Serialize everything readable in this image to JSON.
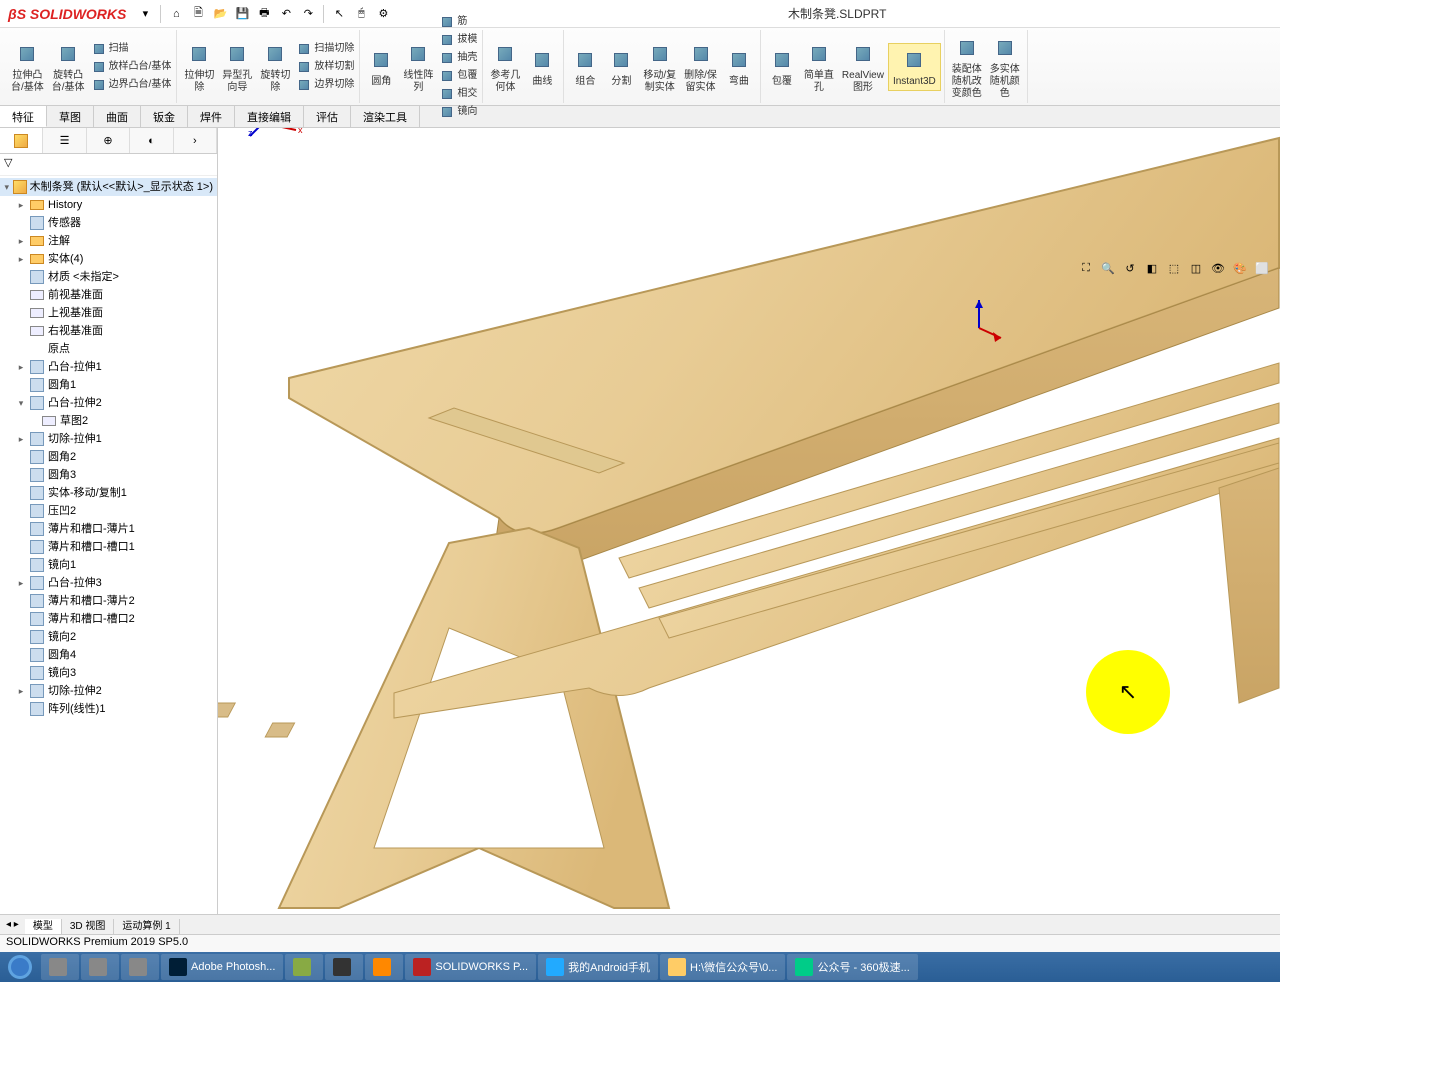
{
  "app": {
    "name": "SOLIDWORKS",
    "doc_title": "木制条凳.SLDPRT"
  },
  "ribbon": {
    "groups": [
      {
        "buttons": [
          {
            "label": "拉伸凸\n台/基体"
          },
          {
            "label": "旋转凸\n台/基体"
          }
        ],
        "side": [
          {
            "label": "扫描"
          },
          {
            "label": "放样凸台/基体"
          },
          {
            "label": "边界凸台/基体"
          }
        ]
      },
      {
        "buttons": [
          {
            "label": "拉伸切\n除"
          },
          {
            "label": "异型孔\n向导"
          },
          {
            "label": "旋转切\n除"
          }
        ],
        "side": [
          {
            "label": "扫描切除"
          },
          {
            "label": "放样切割"
          },
          {
            "label": "边界切除"
          }
        ]
      },
      {
        "buttons": [
          {
            "label": "圆角"
          },
          {
            "label": "线性阵\n列"
          }
        ],
        "side": [
          {
            "label": "筋"
          },
          {
            "label": "拔模"
          },
          {
            "label": "抽壳"
          },
          {
            "label": "包覆"
          },
          {
            "label": "相交"
          },
          {
            "label": "镜向"
          }
        ]
      },
      {
        "buttons": [
          {
            "label": "参考几\n何体"
          },
          {
            "label": "曲线"
          }
        ]
      },
      {
        "buttons": [
          {
            "label": "组合"
          },
          {
            "label": "分割"
          },
          {
            "label": "移动/复\n制实体"
          },
          {
            "label": "删除/保\n留实体"
          },
          {
            "label": "弯曲"
          }
        ]
      },
      {
        "buttons": [
          {
            "label": "包覆"
          },
          {
            "label": "简单直\n孔"
          },
          {
            "label": "RealView\n图形"
          },
          {
            "label": "Instant3D",
            "active": true
          }
        ]
      },
      {
        "buttons": [
          {
            "label": "装配体\n随机改\n变颜色"
          },
          {
            "label": "多实体\n随机颜\n色"
          }
        ]
      }
    ]
  },
  "tabs": [
    "特征",
    "草图",
    "曲面",
    "钣金",
    "焊件",
    "直接编辑",
    "评估",
    "渲染工具"
  ],
  "tree": {
    "root": "木制条凳  (默认<<默认>_显示状态 1>)",
    "items": [
      {
        "label": "History",
        "icon": "folder",
        "indent": 1,
        "toggle": "▸"
      },
      {
        "label": "传感器",
        "icon": "feat",
        "indent": 1
      },
      {
        "label": "注解",
        "icon": "folder",
        "indent": 1,
        "toggle": "▸"
      },
      {
        "label": "实体(4)",
        "icon": "folder",
        "indent": 1,
        "toggle": "▸"
      },
      {
        "label": "材质 <未指定>",
        "icon": "feat",
        "indent": 1
      },
      {
        "label": "前视基准面",
        "icon": "plane",
        "indent": 1
      },
      {
        "label": "上视基准面",
        "icon": "plane",
        "indent": 1
      },
      {
        "label": "右视基准面",
        "icon": "plane",
        "indent": 1
      },
      {
        "label": "原点",
        "icon": "origin",
        "indent": 1
      },
      {
        "label": "凸台-拉伸1",
        "icon": "feat",
        "indent": 1,
        "toggle": "▸"
      },
      {
        "label": "圆角1",
        "icon": "feat",
        "indent": 1
      },
      {
        "label": "凸台-拉伸2",
        "icon": "feat",
        "indent": 1,
        "toggle": "▾"
      },
      {
        "label": "草图2",
        "icon": "sketch",
        "indent": 2
      },
      {
        "label": "切除-拉伸1",
        "icon": "feat",
        "indent": 1,
        "toggle": "▸"
      },
      {
        "label": "圆角2",
        "icon": "feat",
        "indent": 1
      },
      {
        "label": "圆角3",
        "icon": "feat",
        "indent": 1
      },
      {
        "label": "实体-移动/复制1",
        "icon": "feat",
        "indent": 1
      },
      {
        "label": "压凹2",
        "icon": "feat",
        "indent": 1
      },
      {
        "label": "薄片和槽口-薄片1",
        "icon": "feat",
        "indent": 1
      },
      {
        "label": "薄片和槽口-槽口1",
        "icon": "feat",
        "indent": 1
      },
      {
        "label": "镜向1",
        "icon": "feat",
        "indent": 1
      },
      {
        "label": "凸台-拉伸3",
        "icon": "feat",
        "indent": 1,
        "toggle": "▸"
      },
      {
        "label": "薄片和槽口-薄片2",
        "icon": "feat",
        "indent": 1
      },
      {
        "label": "薄片和槽口-槽口2",
        "icon": "feat",
        "indent": 1
      },
      {
        "label": "镜向2",
        "icon": "feat",
        "indent": 1
      },
      {
        "label": "圆角4",
        "icon": "feat",
        "indent": 1
      },
      {
        "label": "镜向3",
        "icon": "feat",
        "indent": 1
      },
      {
        "label": "切除-拉伸2",
        "icon": "feat",
        "indent": 1,
        "toggle": "▸"
      },
      {
        "label": "阵列(线性)1",
        "icon": "feat",
        "indent": 1
      }
    ]
  },
  "bottom_tabs": [
    "模型",
    "3D 视图",
    "运动算例 1"
  ],
  "status": "SOLIDWORKS Premium 2019 SP5.0",
  "taskbar": [
    {
      "label": ""
    },
    {
      "label": ""
    },
    {
      "label": ""
    },
    {
      "label": "Adobe Photosh...",
      "icon": "#001e36"
    },
    {
      "label": "",
      "icon": "#8a4"
    },
    {
      "label": "",
      "icon": "#333"
    },
    {
      "label": "",
      "icon": "#f80"
    },
    {
      "label": "SOLIDWORKS P...",
      "icon": "#b22"
    },
    {
      "label": "我的Android手机",
      "icon": "#2af"
    },
    {
      "label": "H:\\微信公众号\\0...",
      "icon": "#fc6"
    },
    {
      "label": "公众号 - 360极速...",
      "icon": "#0c8"
    }
  ]
}
